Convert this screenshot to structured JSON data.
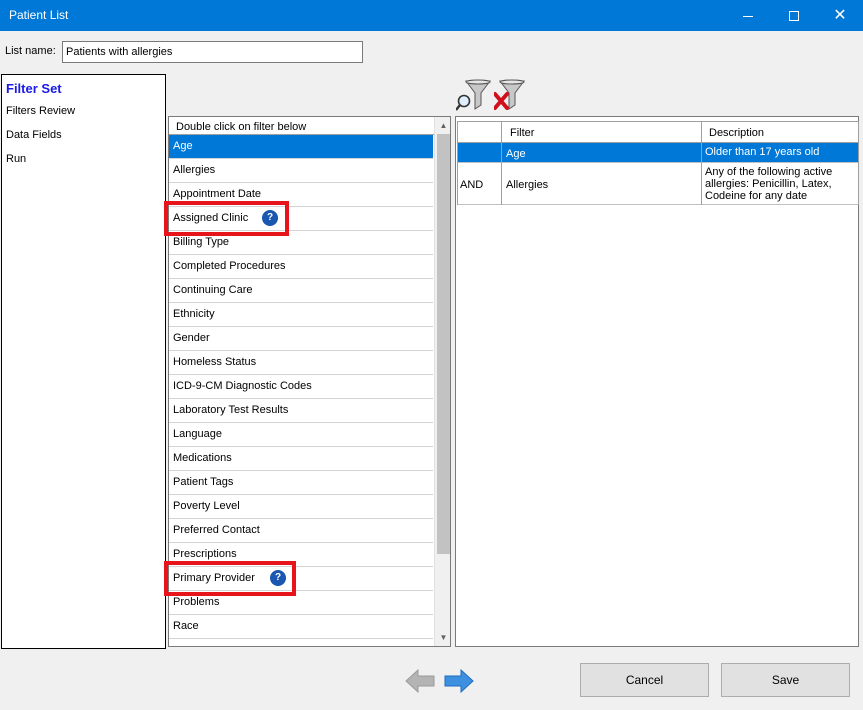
{
  "window": {
    "title": "Patient List",
    "minimize": "—",
    "maximize": "☐",
    "close": "✕"
  },
  "list_name": {
    "label": "List name:",
    "value": "Patients with allergies"
  },
  "sidebar": {
    "heading": "Filter Set",
    "items": [
      {
        "label": "Filters Review"
      },
      {
        "label": "Data Fields"
      },
      {
        "label": "Run"
      }
    ]
  },
  "toolbar": {
    "icons": [
      "filter-search-icon",
      "filter-remove-icon"
    ]
  },
  "filter_list": {
    "header": "Double click on filter below",
    "items": [
      {
        "label": "Age",
        "selected": true
      },
      {
        "label": "Allergies"
      },
      {
        "label": "Appointment Date"
      },
      {
        "label": "Assigned Clinic",
        "help": "?"
      },
      {
        "label": "Billing Type"
      },
      {
        "label": "Completed Procedures"
      },
      {
        "label": "Continuing Care"
      },
      {
        "label": "Ethnicity"
      },
      {
        "label": "Gender"
      },
      {
        "label": "Homeless Status"
      },
      {
        "label": "ICD-9-CM Diagnostic Codes"
      },
      {
        "label": "Laboratory Test Results"
      },
      {
        "label": "Language"
      },
      {
        "label": "Medications"
      },
      {
        "label": "Patient Tags"
      },
      {
        "label": "Poverty Level"
      },
      {
        "label": "Preferred Contact"
      },
      {
        "label": "Prescriptions"
      },
      {
        "label": "Primary Provider",
        "help": "?"
      },
      {
        "label": "Problems"
      },
      {
        "label": "Race"
      }
    ]
  },
  "result_table": {
    "columns": [
      "",
      "Filter",
      "Description"
    ],
    "rows": [
      {
        "op": "",
        "filter": "Age",
        "description": "Older than 17 years old",
        "selected": true
      },
      {
        "op": "AND",
        "filter": "Allergies",
        "description": "Any of the following active allergies: Penicillin, Latex, Codeine for any date"
      }
    ]
  },
  "footer": {
    "back_icon": "arrow-left-icon",
    "next_icon": "arrow-right-icon",
    "cancel_label": "Cancel",
    "save_label": "Save"
  },
  "colors": {
    "titlebar": "#0078d7",
    "selection": "#0078d7",
    "highlight": "#e8141b",
    "sidebar_heading": "#1a1ae6",
    "help_badge": "#1a57b0"
  }
}
